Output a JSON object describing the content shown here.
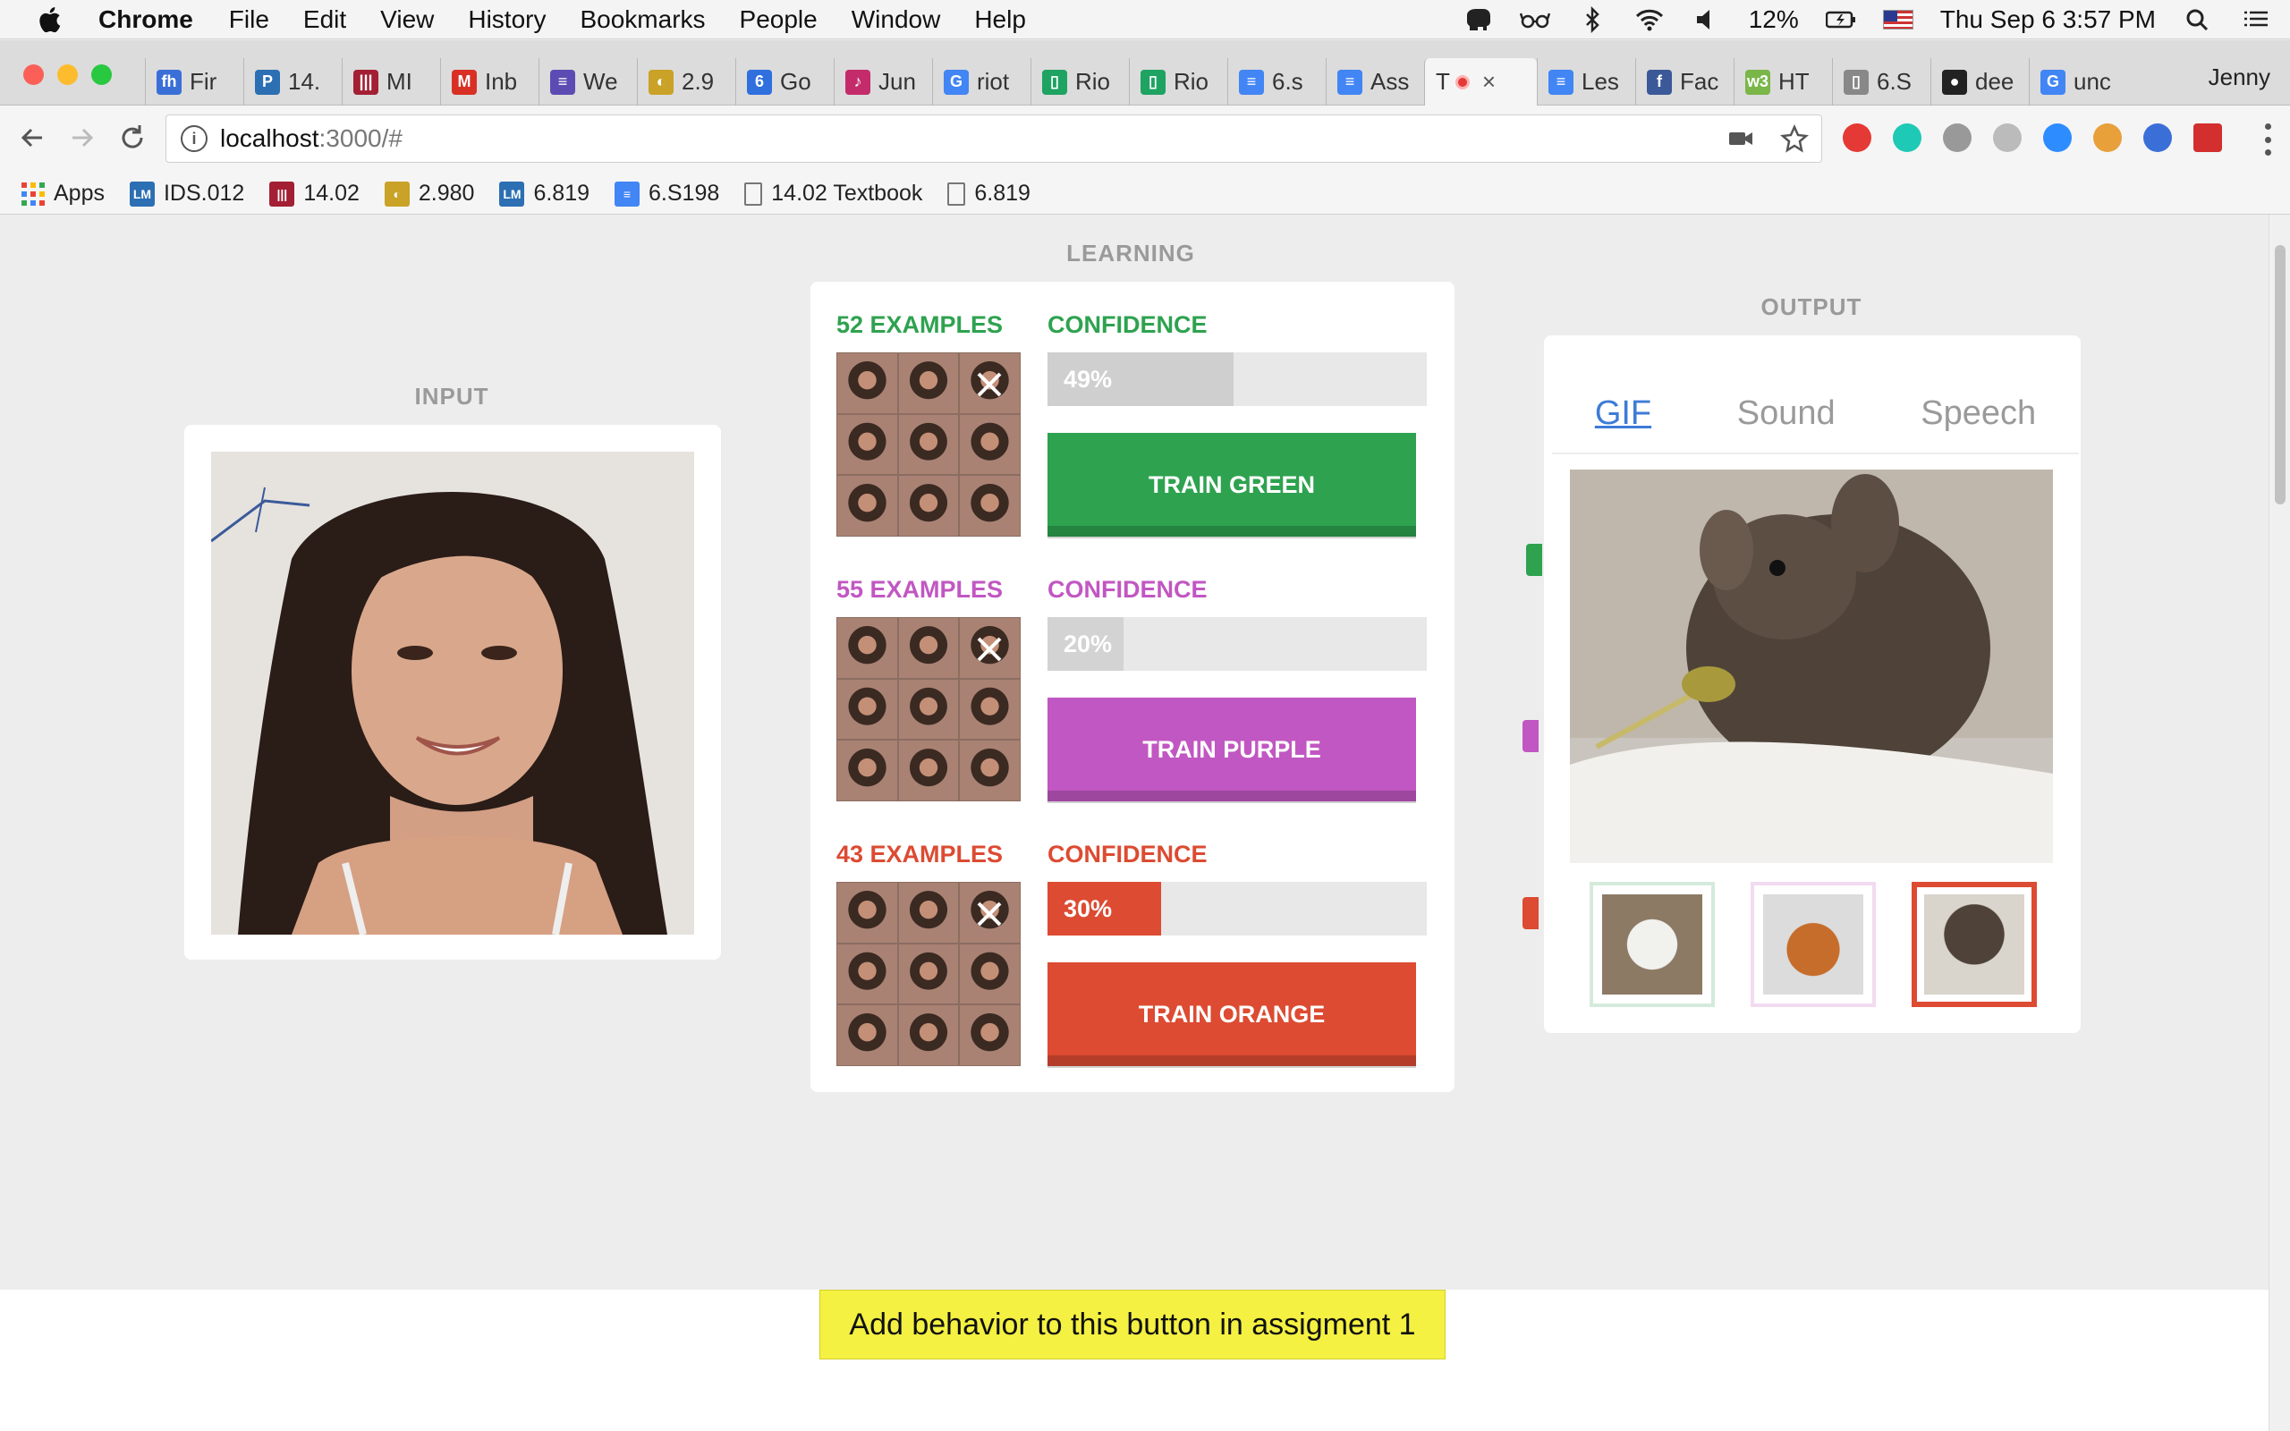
{
  "menubar": {
    "app": "Chrome",
    "items": [
      "File",
      "Edit",
      "View",
      "History",
      "Bookmarks",
      "People",
      "Window",
      "Help"
    ],
    "battery": "12%",
    "datetime": "Thu Sep 6  3:57 PM"
  },
  "tabs": [
    {
      "label": "Fir",
      "color": "#3a6fd8",
      "icon": "fh"
    },
    {
      "label": "14.",
      "color": "#2c6fb3",
      "icon": "P"
    },
    {
      "label": "MI",
      "color": "#a31f34",
      "icon": "|||"
    },
    {
      "label": "Inb",
      "color": "#d93025",
      "icon": "M"
    },
    {
      "label": "We",
      "color": "#5c4bb3",
      "icon": "≡"
    },
    {
      "label": "2.9",
      "color": "#c9a227",
      "icon": "◐"
    },
    {
      "label": "Go",
      "color": "#2f6fde",
      "icon": "6"
    },
    {
      "label": "Jun",
      "color": "#c42b6a",
      "icon": "♪"
    },
    {
      "label": "riot",
      "color": "#4285f4",
      "icon": "G"
    },
    {
      "label": "Rio",
      "color": "#1ea362",
      "icon": "▯"
    },
    {
      "label": "Rio",
      "color": "#1ea362",
      "icon": "▯"
    },
    {
      "label": "6.s",
      "color": "#4285f4",
      "icon": "≡"
    },
    {
      "label": "Ass",
      "color": "#4285f4",
      "icon": "≡"
    },
    {
      "label": "T",
      "color": "",
      "icon": "",
      "active": true,
      "close": "×"
    },
    {
      "label": "Les",
      "color": "#4285f4",
      "icon": "≡"
    },
    {
      "label": "Fac",
      "color": "#3b5998",
      "icon": "f"
    },
    {
      "label": "HT",
      "color": "#7ab648",
      "icon": "w3"
    },
    {
      "label": "6.S",
      "color": "#888888",
      "icon": "▯"
    },
    {
      "label": "dee",
      "color": "#222222",
      "icon": "●"
    },
    {
      "label": "unc",
      "color": "#4285f4",
      "icon": "G"
    }
  ],
  "profile": "Jenny",
  "address": {
    "host": "localhost",
    "rest": ":3000/#"
  },
  "bookmarks": [
    {
      "label": "Apps",
      "type": "apps"
    },
    {
      "label": "IDS.012",
      "type": "lm",
      "color": "#2c6fb3",
      "icon": "LM"
    },
    {
      "label": "14.02",
      "type": "lm",
      "color": "#a31f34",
      "icon": "|||"
    },
    {
      "label": "2.980",
      "type": "lm",
      "color": "#c9a227",
      "icon": "◐"
    },
    {
      "label": "6.819",
      "type": "lm",
      "color": "#2c6fb3",
      "icon": "LM"
    },
    {
      "label": "6.S198",
      "type": "lm",
      "color": "#4285f4",
      "icon": "≡"
    },
    {
      "label": "14.02 Textbook",
      "type": "doc"
    },
    {
      "label": "6.819",
      "type": "doc"
    }
  ],
  "sections": {
    "input": "INPUT",
    "learning": "LEARNING",
    "output": "OUTPUT"
  },
  "classes": [
    {
      "name": "green",
      "examples": "52 EXAMPLES",
      "confidence_label": "CONFIDENCE",
      "confidence": "49%",
      "confidence_value": 0.49,
      "button": "TRAIN GREEN",
      "color": "#2ea24f",
      "text_color": "#2ea24f"
    },
    {
      "name": "purple",
      "examples": "55 EXAMPLES",
      "confidence_label": "CONFIDENCE",
      "confidence": "20%",
      "confidence_value": 0.2,
      "button": "TRAIN PURPLE",
      "color": "#c157c2",
      "text_color": "#c157c2"
    },
    {
      "name": "orange",
      "examples": "43 EXAMPLES",
      "confidence_label": "CONFIDENCE",
      "confidence": "30%",
      "confidence_value": 0.3,
      "button": "TRAIN ORANGE",
      "color": "#dc4b32",
      "text_color": "#dc4b32"
    }
  ],
  "output": {
    "tabs": [
      "GIF",
      "Sound",
      "Speech"
    ],
    "active_tab": "GIF"
  },
  "assignment_button": "Add behavior to this button in assigment 1"
}
